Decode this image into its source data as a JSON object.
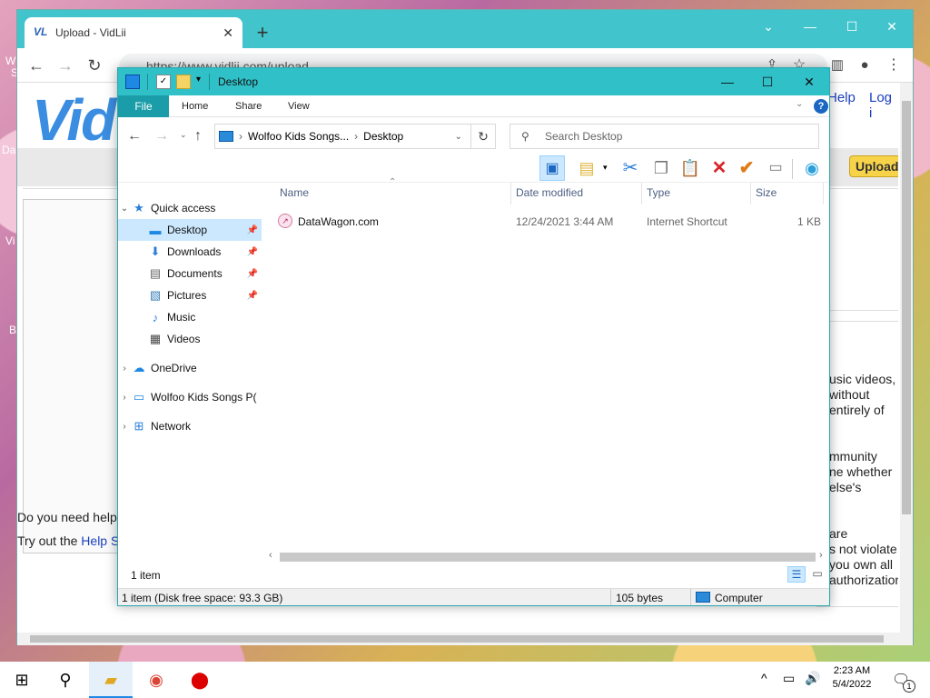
{
  "desktop": {
    "left_clip_items": [
      "W",
      "S",
      "Da",
      "Vi",
      "B"
    ]
  },
  "browser": {
    "tab_title": "Upload - VidLii",
    "tab_favicon": "VL",
    "url": "https://www.vidlii.com/upload",
    "page": {
      "logo_text": "Vid",
      "help_link": "Help",
      "login_link": "Log i",
      "upload_button": "Upload",
      "help_question": "Do you need help",
      "help_try": "Try out the ",
      "help_try_link": "Help S",
      "right_text": [
        "usic videos,",
        "without",
        "entirely of",
        "mmunity",
        "ne whether",
        "else's",
        "are",
        "s not violate",
        "you own all",
        "authorization"
      ]
    }
  },
  "explorer": {
    "title": "Desktop",
    "ribbon_tabs": [
      "File",
      "Home",
      "Share",
      "View"
    ],
    "address_path": [
      "Wolfoo Kids Songs...",
      "Desktop"
    ],
    "search_placeholder": "Search Desktop",
    "nav": {
      "quick_access": "Quick access",
      "items": [
        {
          "label": "Desktop",
          "icon": "desktop-icon",
          "pinned": true,
          "selected": true
        },
        {
          "label": "Downloads",
          "icon": "downloads-icon",
          "pinned": true,
          "selected": false
        },
        {
          "label": "Documents",
          "icon": "documents-icon",
          "pinned": true,
          "selected": false
        },
        {
          "label": "Pictures",
          "icon": "pictures-icon",
          "pinned": true,
          "selected": false
        },
        {
          "label": "Music",
          "icon": "music-icon",
          "pinned": false,
          "selected": false
        },
        {
          "label": "Videos",
          "icon": "videos-icon",
          "pinned": false,
          "selected": false
        }
      ],
      "onedrive": "OneDrive",
      "this_pc": "Wolfoo Kids Songs P(",
      "network": "Network"
    },
    "columns": [
      "Name",
      "Date modified",
      "Type",
      "Size"
    ],
    "files": [
      {
        "name": "DataWagon.com",
        "date": "12/24/2021 3:44 AM",
        "type": "Internet Shortcut",
        "size": "1 KB"
      }
    ],
    "item_count": "1 item",
    "status": {
      "left": "1 item (Disk free space: 93.3 GB)",
      "size": "105 bytes",
      "location": "Computer"
    }
  },
  "taskbar": {
    "time": "2:23 AM",
    "date": "5/4/2022",
    "notification_count": "1"
  },
  "colors": {
    "browser_frame": "#42c4cc",
    "explorer_title": "#2fc0c8",
    "file_tab": "#1a9da8",
    "selection": "#cce8ff"
  }
}
